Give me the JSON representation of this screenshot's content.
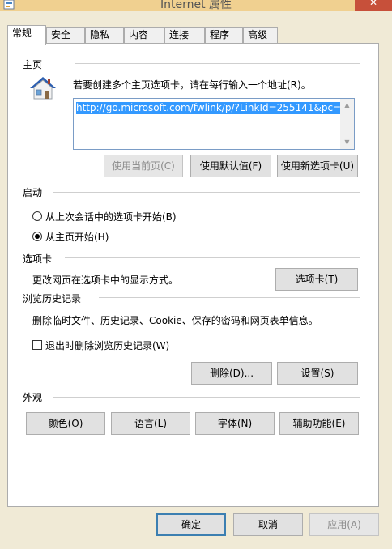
{
  "window": {
    "title": "Internet 属性",
    "close_label": "✕"
  },
  "tabs": [
    {
      "label": "常规",
      "active": true
    },
    {
      "label": "安全"
    },
    {
      "label": "隐私"
    },
    {
      "label": "内容"
    },
    {
      "label": "连接"
    },
    {
      "label": "程序"
    },
    {
      "label": "高级"
    }
  ],
  "home": {
    "title": "主页",
    "description": "若要创建多个主页选项卡，请在每行输入一个地址(R)。",
    "url": "http://go.microsoft.com/fwlink/p/?LinkId=255141&pc=",
    "buttons": {
      "use_current": "使用当前页(C)",
      "use_default": "使用默认值(F)",
      "use_new_tab": "使用新选项卡(U)"
    }
  },
  "startup": {
    "title": "启动",
    "option_last_session": "从上次会话中的选项卡开始(B)",
    "option_home": "从主页开始(H)",
    "selected": "option_home"
  },
  "tabs_section": {
    "title": "选项卡",
    "description": "更改网页在选项卡中的显示方式。",
    "button": "选项卡(T)"
  },
  "history": {
    "title": "浏览历史记录",
    "description": "删除临时文件、历史记录、Cookie、保存的密码和网页表单信息。",
    "delete_on_exit_label": "退出时删除浏览历史记录(W)",
    "delete_on_exit_checked": false,
    "delete_button": "删除(D)...",
    "settings_button": "设置(S)"
  },
  "appearance": {
    "title": "外观",
    "colors_button": "颜色(O)",
    "languages_button": "语言(L)",
    "fonts_button": "字体(N)",
    "accessibility_button": "辅助功能(E)"
  },
  "footer": {
    "ok": "确定",
    "cancel": "取消",
    "apply": "应用(A)"
  }
}
